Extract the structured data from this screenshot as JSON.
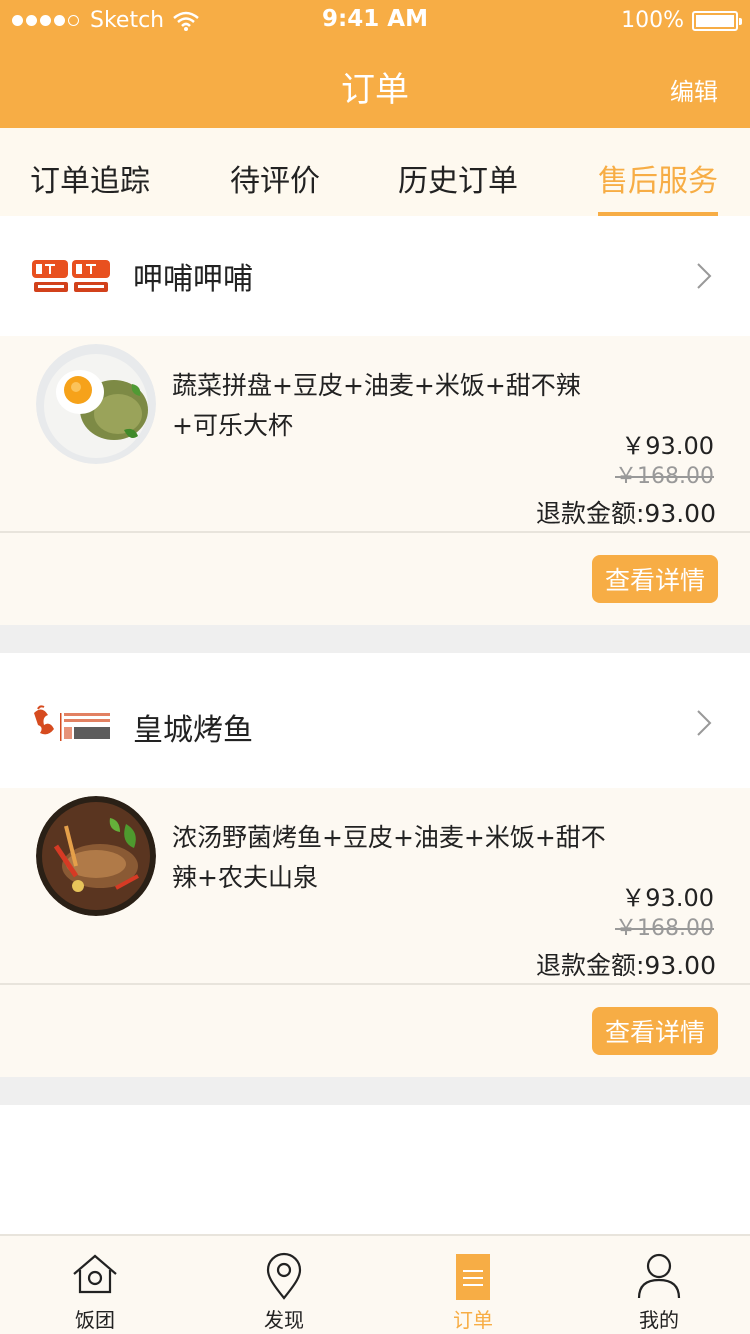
{
  "status_bar": {
    "carrier": "Sketch",
    "time": "9:41 AM",
    "battery": "100%"
  },
  "nav": {
    "title": "订单",
    "edit_label": "编辑"
  },
  "tabs": [
    {
      "label": "订单追踪",
      "active": false
    },
    {
      "label": "待评价",
      "active": false
    },
    {
      "label": "历史订单",
      "active": false
    },
    {
      "label": "售后服务",
      "active": true
    }
  ],
  "orders": [
    {
      "store_name": "呷哺呷哺",
      "store_logo_icon": "xiabu-logo",
      "item_name": "蔬菜拼盘+豆皮+油麦+米饭+甜不辣+可乐大杯",
      "price": "￥93.00",
      "original_price": "￥168.00",
      "refund": "退款金额:93.00",
      "detail_label": "查看详情",
      "thumb_icon": "fried-egg-dish-image"
    },
    {
      "store_name": "皇城烤鱼",
      "store_logo_icon": "huangcheng-logo",
      "item_name": "浓汤野菌烤鱼+豆皮+油麦+米饭+甜不辣+农夫山泉",
      "price": "￥93.00",
      "original_price": "￥168.00",
      "refund": "退款金额:93.00",
      "detail_label": "查看详情",
      "thumb_icon": "grilled-fish-image"
    }
  ],
  "tabbar": [
    {
      "label": "饭团",
      "icon": "home-icon",
      "active": false
    },
    {
      "label": "发现",
      "icon": "location-pin-icon",
      "active": false
    },
    {
      "label": "订单",
      "icon": "order-list-icon",
      "active": true
    },
    {
      "label": "我的",
      "icon": "user-icon",
      "active": false
    }
  ],
  "colors": {
    "accent": "#f7ad45",
    "card_bg": "#fdf9f2",
    "divider": "#efefef"
  }
}
